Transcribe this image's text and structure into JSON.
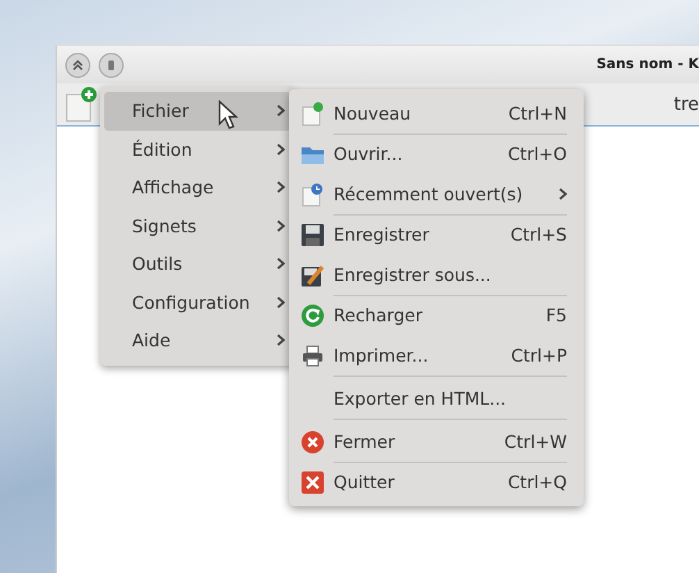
{
  "window": {
    "title": "Sans nom - K"
  },
  "toolbar": {
    "text_cut": "tre"
  },
  "menu": [
    {
      "label": "Fichier",
      "selected": true
    },
    {
      "label": "Édition",
      "selected": false
    },
    {
      "label": "Affichage",
      "selected": false
    },
    {
      "label": "Signets",
      "selected": false
    },
    {
      "label": "Outils",
      "selected": false
    },
    {
      "label": "Configuration",
      "selected": false
    },
    {
      "label": "Aide",
      "selected": false
    }
  ],
  "submenu": [
    {
      "kind": "new",
      "label": "Nouveau",
      "shortcut": "Ctrl+N",
      "separator_after": true
    },
    {
      "kind": "open",
      "label": "Ouvrir...",
      "shortcut": "Ctrl+O",
      "separator_after": false
    },
    {
      "kind": "recent",
      "label": "Récemment ouvert(s)",
      "submenu": true,
      "separator_after": true
    },
    {
      "kind": "save",
      "label": "Enregistrer",
      "shortcut": "Ctrl+S",
      "separator_after": false
    },
    {
      "kind": "saveas",
      "label": "Enregistrer sous...",
      "separator_after": true
    },
    {
      "kind": "reload",
      "label": "Recharger",
      "shortcut": "F5",
      "separator_after": false
    },
    {
      "kind": "print",
      "label": "Imprimer...",
      "shortcut": "Ctrl+P",
      "separator_after": true
    },
    {
      "kind": "none",
      "label": "Exporter en HTML...",
      "separator_after": true
    },
    {
      "kind": "close",
      "label": "Fermer",
      "shortcut": "Ctrl+W",
      "separator_after": true
    },
    {
      "kind": "quit",
      "label": "Quitter",
      "shortcut": "Ctrl+Q",
      "separator_after": false
    }
  ]
}
